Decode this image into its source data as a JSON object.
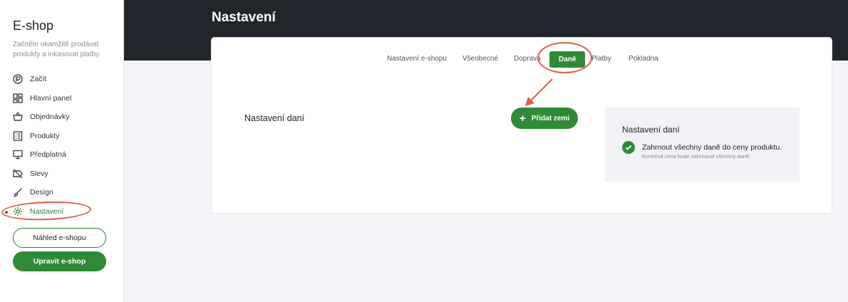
{
  "sidebar": {
    "title": "E-shop",
    "subtitle": "Začněte okamžitě prodávat produkty a inkasovat platby.",
    "items": [
      {
        "label": "Začít",
        "icon": "start-icon"
      },
      {
        "label": "Hlavní panel",
        "icon": "dashboard-icon"
      },
      {
        "label": "Objednávky",
        "icon": "basket-icon"
      },
      {
        "label": "Produkty",
        "icon": "list-icon"
      },
      {
        "label": "Předplatná",
        "icon": "subscription-icon"
      },
      {
        "label": "Slevy",
        "icon": "discount-icon"
      },
      {
        "label": "Design",
        "icon": "brush-icon"
      },
      {
        "label": "Nastavení",
        "icon": "gear-icon",
        "active": true
      }
    ],
    "preview_button": "Náhled e-shopu",
    "edit_button": "Upravit e-shop"
  },
  "header": {
    "title": "Nastavení"
  },
  "tabs": [
    {
      "label": "Nastavení e-shopu"
    },
    {
      "label": "Všeobecné"
    },
    {
      "label": "Doprava"
    },
    {
      "label": "Daně",
      "active": true
    },
    {
      "label": "Platby"
    },
    {
      "label": "Pokladna"
    }
  ],
  "main": {
    "section_title": "Nastavení daní",
    "add_button": "Přidat zemi",
    "panel": {
      "title": "Nastavení daní",
      "option_label": "Zahrnout všechny daně do ceny produktu.",
      "option_desc": "Konečná cena bude zahrnovat všechny daně."
    }
  },
  "colors": {
    "accent": "#2e8b34",
    "header_bg": "#22252b",
    "annotation": "#e45a4a"
  }
}
